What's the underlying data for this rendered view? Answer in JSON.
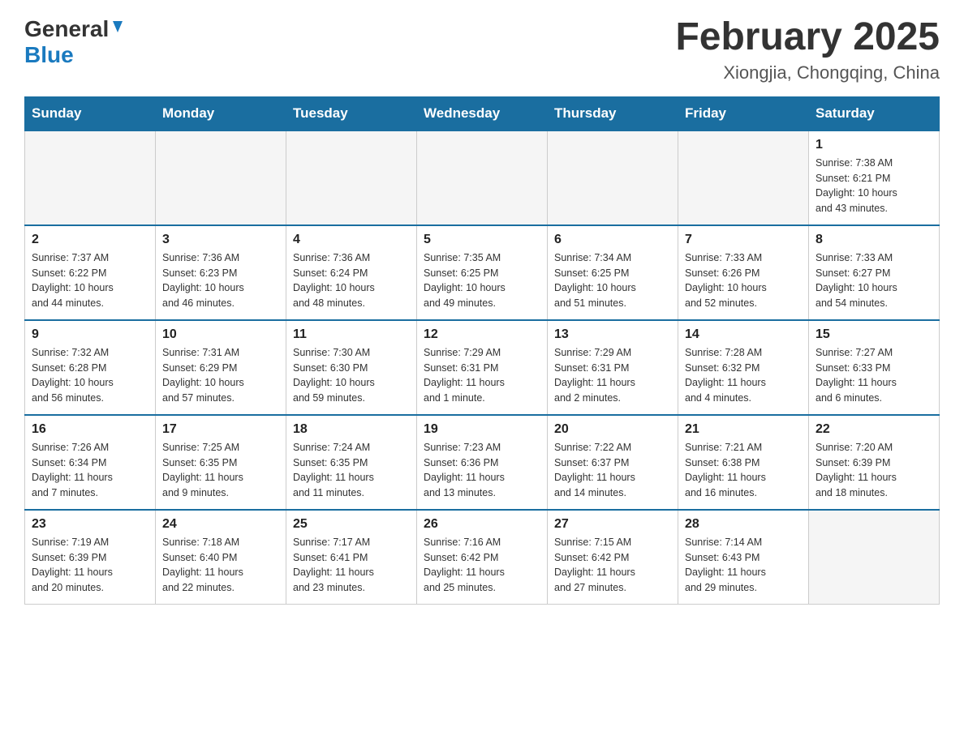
{
  "header": {
    "logo_general": "General",
    "logo_blue": "Blue",
    "title": "February 2025",
    "subtitle": "Xiongjia, Chongqing, China"
  },
  "days_of_week": [
    "Sunday",
    "Monday",
    "Tuesday",
    "Wednesday",
    "Thursday",
    "Friday",
    "Saturday"
  ],
  "weeks": [
    [
      {
        "num": "",
        "info": ""
      },
      {
        "num": "",
        "info": ""
      },
      {
        "num": "",
        "info": ""
      },
      {
        "num": "",
        "info": ""
      },
      {
        "num": "",
        "info": ""
      },
      {
        "num": "",
        "info": ""
      },
      {
        "num": "1",
        "info": "Sunrise: 7:38 AM\nSunset: 6:21 PM\nDaylight: 10 hours\nand 43 minutes."
      }
    ],
    [
      {
        "num": "2",
        "info": "Sunrise: 7:37 AM\nSunset: 6:22 PM\nDaylight: 10 hours\nand 44 minutes."
      },
      {
        "num": "3",
        "info": "Sunrise: 7:36 AM\nSunset: 6:23 PM\nDaylight: 10 hours\nand 46 minutes."
      },
      {
        "num": "4",
        "info": "Sunrise: 7:36 AM\nSunset: 6:24 PM\nDaylight: 10 hours\nand 48 minutes."
      },
      {
        "num": "5",
        "info": "Sunrise: 7:35 AM\nSunset: 6:25 PM\nDaylight: 10 hours\nand 49 minutes."
      },
      {
        "num": "6",
        "info": "Sunrise: 7:34 AM\nSunset: 6:25 PM\nDaylight: 10 hours\nand 51 minutes."
      },
      {
        "num": "7",
        "info": "Sunrise: 7:33 AM\nSunset: 6:26 PM\nDaylight: 10 hours\nand 52 minutes."
      },
      {
        "num": "8",
        "info": "Sunrise: 7:33 AM\nSunset: 6:27 PM\nDaylight: 10 hours\nand 54 minutes."
      }
    ],
    [
      {
        "num": "9",
        "info": "Sunrise: 7:32 AM\nSunset: 6:28 PM\nDaylight: 10 hours\nand 56 minutes."
      },
      {
        "num": "10",
        "info": "Sunrise: 7:31 AM\nSunset: 6:29 PM\nDaylight: 10 hours\nand 57 minutes."
      },
      {
        "num": "11",
        "info": "Sunrise: 7:30 AM\nSunset: 6:30 PM\nDaylight: 10 hours\nand 59 minutes."
      },
      {
        "num": "12",
        "info": "Sunrise: 7:29 AM\nSunset: 6:31 PM\nDaylight: 11 hours\nand 1 minute."
      },
      {
        "num": "13",
        "info": "Sunrise: 7:29 AM\nSunset: 6:31 PM\nDaylight: 11 hours\nand 2 minutes."
      },
      {
        "num": "14",
        "info": "Sunrise: 7:28 AM\nSunset: 6:32 PM\nDaylight: 11 hours\nand 4 minutes."
      },
      {
        "num": "15",
        "info": "Sunrise: 7:27 AM\nSunset: 6:33 PM\nDaylight: 11 hours\nand 6 minutes."
      }
    ],
    [
      {
        "num": "16",
        "info": "Sunrise: 7:26 AM\nSunset: 6:34 PM\nDaylight: 11 hours\nand 7 minutes."
      },
      {
        "num": "17",
        "info": "Sunrise: 7:25 AM\nSunset: 6:35 PM\nDaylight: 11 hours\nand 9 minutes."
      },
      {
        "num": "18",
        "info": "Sunrise: 7:24 AM\nSunset: 6:35 PM\nDaylight: 11 hours\nand 11 minutes."
      },
      {
        "num": "19",
        "info": "Sunrise: 7:23 AM\nSunset: 6:36 PM\nDaylight: 11 hours\nand 13 minutes."
      },
      {
        "num": "20",
        "info": "Sunrise: 7:22 AM\nSunset: 6:37 PM\nDaylight: 11 hours\nand 14 minutes."
      },
      {
        "num": "21",
        "info": "Sunrise: 7:21 AM\nSunset: 6:38 PM\nDaylight: 11 hours\nand 16 minutes."
      },
      {
        "num": "22",
        "info": "Sunrise: 7:20 AM\nSunset: 6:39 PM\nDaylight: 11 hours\nand 18 minutes."
      }
    ],
    [
      {
        "num": "23",
        "info": "Sunrise: 7:19 AM\nSunset: 6:39 PM\nDaylight: 11 hours\nand 20 minutes."
      },
      {
        "num": "24",
        "info": "Sunrise: 7:18 AM\nSunset: 6:40 PM\nDaylight: 11 hours\nand 22 minutes."
      },
      {
        "num": "25",
        "info": "Sunrise: 7:17 AM\nSunset: 6:41 PM\nDaylight: 11 hours\nand 23 minutes."
      },
      {
        "num": "26",
        "info": "Sunrise: 7:16 AM\nSunset: 6:42 PM\nDaylight: 11 hours\nand 25 minutes."
      },
      {
        "num": "27",
        "info": "Sunrise: 7:15 AM\nSunset: 6:42 PM\nDaylight: 11 hours\nand 27 minutes."
      },
      {
        "num": "28",
        "info": "Sunrise: 7:14 AM\nSunset: 6:43 PM\nDaylight: 11 hours\nand 29 minutes."
      },
      {
        "num": "",
        "info": ""
      }
    ]
  ]
}
